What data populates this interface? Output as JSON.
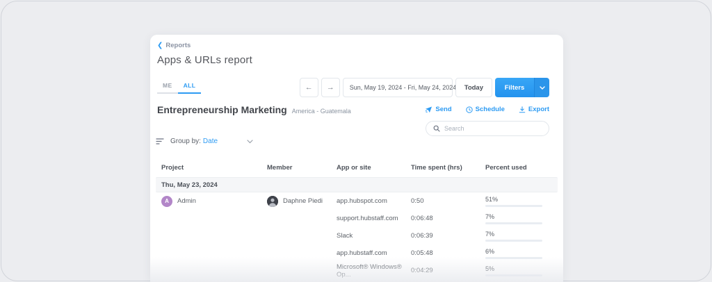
{
  "colors": {
    "accent_blue": "#2d9bf3",
    "bar_blue": "#2e9bf0",
    "bar_gray": "#565f69",
    "page_bg": "#ecedf0"
  },
  "breadcrumb": {
    "label": "Reports",
    "chevron": "‹"
  },
  "page_title": "Apps & URLs report",
  "tabs": [
    {
      "label": "ME",
      "active": false
    },
    {
      "label": "ALL",
      "active": true
    }
  ],
  "controls": {
    "prev_arrow": "←",
    "next_arrow": "→",
    "date_range": "Sun, May 19, 2024 - Fri, May 24, 2024",
    "today_label": "Today",
    "filters_label": "Filters"
  },
  "section": {
    "title": "Entrepreneurship Marketing",
    "subtitle": "America - Guatemala",
    "actions": {
      "send": "Send",
      "schedule": "Schedule",
      "export": "Export"
    },
    "search_placeholder": "Search",
    "group_by_label": "Group by:",
    "group_by_value": "Date"
  },
  "table": {
    "columns": {
      "project": "Project",
      "member": "Member",
      "app": "App or site",
      "time": "Time spent (hrs)",
      "percent": "Percent used"
    },
    "group_label": "Thu, May 23, 2024",
    "project_name": "Admin",
    "project_avatar_initial": "A",
    "member_name": "Daphne Piedi",
    "rows": [
      {
        "app": "app.hubspot.com",
        "time": "0:50",
        "percent": "51%",
        "value": 51,
        "bar_color": "#2e9bf0"
      },
      {
        "app": "support.hubstaff.com",
        "time": "0:06:48",
        "percent": "7%",
        "value": 7,
        "bar_color": "#2e9bf0"
      },
      {
        "app": "Slack",
        "time": "0:06:39",
        "percent": "7%",
        "value": 7,
        "bar_color": "#565f69"
      },
      {
        "app": "app.hubstaff.com",
        "time": "0:05:48",
        "percent": "6%",
        "value": 6,
        "bar_color": "#2e9bf0"
      },
      {
        "app": "Microsoft® Windows® Op...",
        "time": "0:04:29",
        "percent": "5%",
        "value": 5,
        "bar_color": "#565f69"
      }
    ]
  }
}
